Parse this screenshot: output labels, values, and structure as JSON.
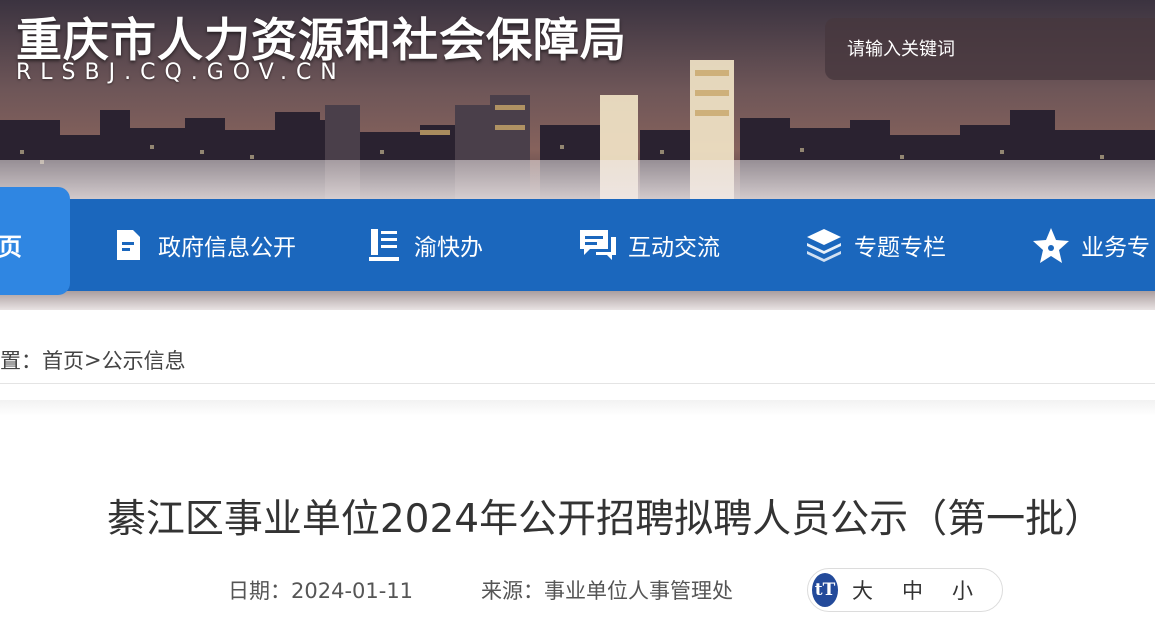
{
  "header": {
    "site_title": "重庆市人力资源和社会保障局",
    "site_domain": "RLSBJ.CQ.GOV.CN",
    "search_placeholder": "请输入关键词"
  },
  "nav": {
    "items": [
      {
        "label": "页",
        "icon": "home"
      },
      {
        "label": "政府信息公开",
        "icon": "document-icon"
      },
      {
        "label": "渝快办",
        "icon": "form-list-icon"
      },
      {
        "label": "互动交流",
        "icon": "chat-bubble-icon"
      },
      {
        "label": "专题专栏",
        "icon": "layers-icon"
      },
      {
        "label": "业务专",
        "icon": "star-icon"
      }
    ]
  },
  "breadcrumb": {
    "prefix": "置：",
    "home": "首页",
    "separator": ">",
    "current": "公示信息"
  },
  "article": {
    "title": "綦江区事业单位2024年公开招聘拟聘人员公示（第一批）",
    "date_label": "日期：",
    "date": "2024-01-11",
    "source_label": "来源：",
    "source": "事业单位人事管理处"
  },
  "font_size": {
    "icon": "font-size-icon",
    "icon_text": "tT",
    "options": [
      "大",
      "中",
      "小"
    ]
  },
  "colors": {
    "nav_bg": "#1b67bd",
    "nav_active": "#2f86e2",
    "font_icon_bg": "#234a9a"
  }
}
